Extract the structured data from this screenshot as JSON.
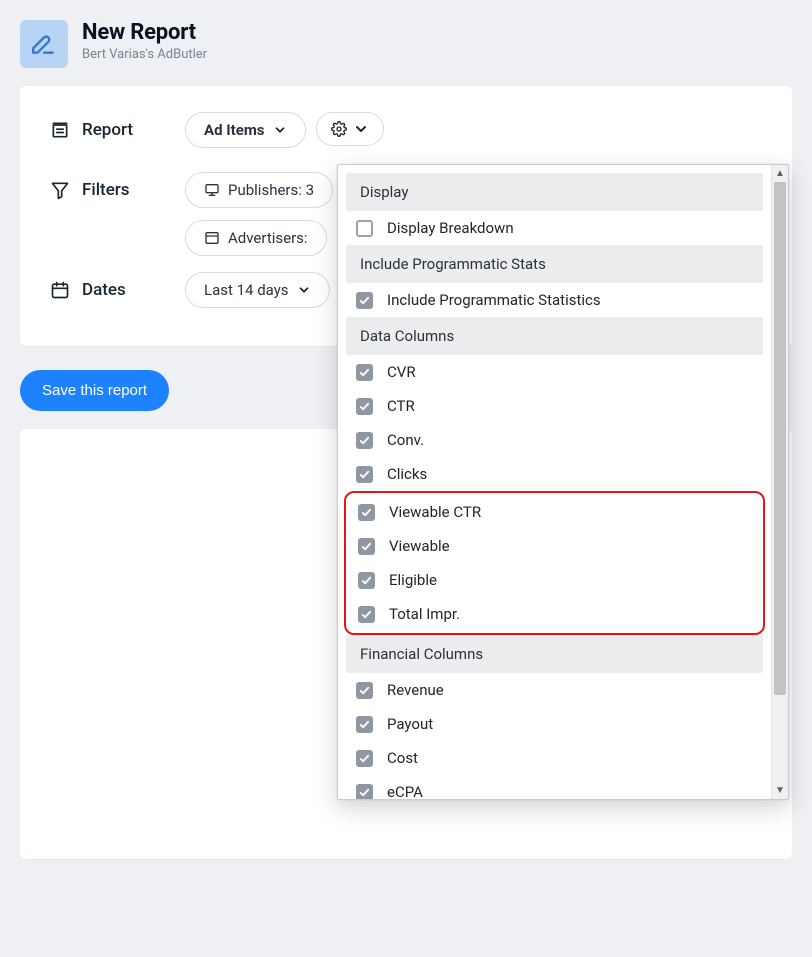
{
  "header": {
    "title": "New Report",
    "subtitle": "Bert Varias's AdButler"
  },
  "rows": {
    "report": {
      "label": "Report",
      "type_button": "Ad Items"
    },
    "filters": {
      "label": "Filters",
      "publishers": "Publishers: 3",
      "advertisers": "Advertisers:"
    },
    "dates": {
      "label": "Dates",
      "range_button": "Last 14 days"
    }
  },
  "save_button": "Save this report",
  "dropdown": {
    "sections": [
      {
        "title": "Display",
        "items": [
          {
            "label": "Display Breakdown",
            "checked": false
          }
        ]
      },
      {
        "title": "Include Programmatic Stats",
        "items": [
          {
            "label": "Include Programmatic Statistics",
            "checked": true
          }
        ]
      },
      {
        "title": "Data Columns",
        "items": [
          {
            "label": "CVR",
            "checked": true
          },
          {
            "label": "CTR",
            "checked": true
          },
          {
            "label": "Conv.",
            "checked": true
          },
          {
            "label": "Clicks",
            "checked": true
          }
        ],
        "highlighted_items": [
          {
            "label": "Viewable CTR",
            "checked": true
          },
          {
            "label": "Viewable",
            "checked": true
          },
          {
            "label": "Eligible",
            "checked": true
          },
          {
            "label": "Total Impr.",
            "checked": true
          }
        ]
      },
      {
        "title": "Financial Columns",
        "items": [
          {
            "label": "Revenue",
            "checked": true
          },
          {
            "label": "Payout",
            "checked": true
          },
          {
            "label": "Cost",
            "checked": true
          },
          {
            "label": "eCPA",
            "checked": true
          }
        ]
      }
    ]
  }
}
